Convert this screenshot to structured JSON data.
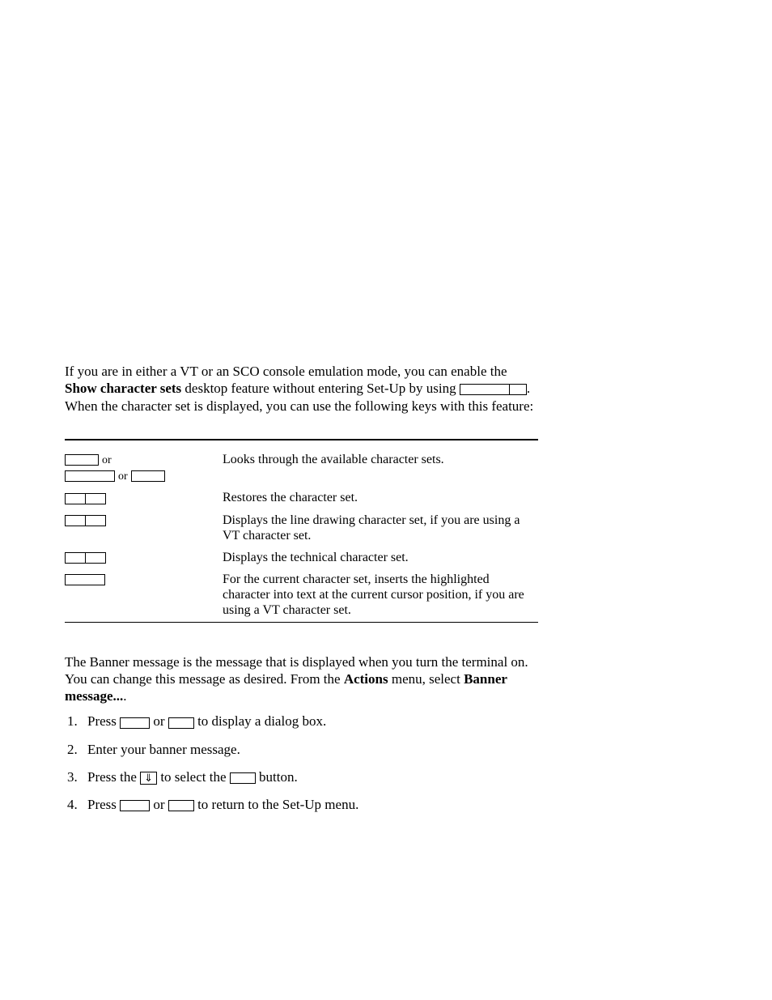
{
  "intro": {
    "text1": "If you are in either a VT or an SCO console emulation mode, you can enable the ",
    "bold1": "Show character sets",
    "text2": " desktop feature without entering Set-Up by using ",
    "text3": ". When the character set is displayed, you can use the following keys with this feature:"
  },
  "table": {
    "rows": [
      {
        "or1": "or",
        "or2": "or",
        "desc": "Looks through the available character sets."
      },
      {
        "desc": "Restores the character set."
      },
      {
        "desc": "Displays the line drawing character set, if you are using a VT character set."
      },
      {
        "desc": "Displays the technical character set."
      },
      {
        "desc": "For the current character set, inserts the highlighted character into text at the current cursor position, if you are using a VT character set."
      }
    ]
  },
  "banner": {
    "text1": "The Banner message is the message that is displayed when you turn the terminal on. You can change this message as desired. From the ",
    "bold1": "Actions",
    "text2": " menu, select ",
    "bold2": "Banner message...",
    "text3": "."
  },
  "steps": [
    {
      "pre": "Press ",
      "mid": " or ",
      "post": " to display a dialog box."
    },
    {
      "text": "Enter your banner message."
    },
    {
      "pre": "Press the ",
      "arrow": "⇓",
      "mid": " to select the ",
      "post": " button."
    },
    {
      "pre": "Press ",
      "mid": " or ",
      "post": " to return to the Set-Up menu."
    }
  ]
}
